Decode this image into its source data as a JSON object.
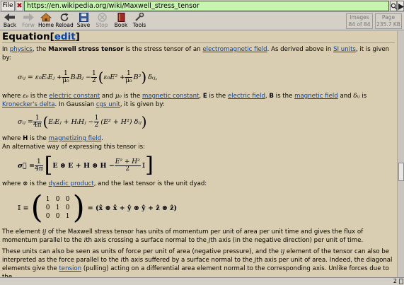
{
  "urlbar": {
    "file_label": "File",
    "close_label": "✖",
    "url": "https://en.wikipedia.org/wiki/Maxwell_stress_tensor"
  },
  "toolbar": {
    "back": "Back",
    "forw": "Forw",
    "home": "Home",
    "reload": "Reload",
    "save": "Save",
    "stop": "Stop",
    "book": "Book",
    "tools": "Tools",
    "images_label": "Images",
    "images_count": "84 of 84",
    "page_label": "Page",
    "page_size": "235.7 KB"
  },
  "article": {
    "heading": "Equation",
    "edit_label": "edit",
    "p1": {
      "t1": "In ",
      "link_physics": "physics",
      "t2": ", the ",
      "bold_term": "Maxwell stress tensor",
      "t3": " is the stress tensor of an ",
      "link_em_field": "electromagnetic field",
      "t4": ". As derived above in ",
      "link_si": "SI units",
      "t5": ", it is given by:"
    },
    "p2": {
      "t1": "where ",
      "sym_eps": "ε₀",
      "t2": " is the ",
      "link_electric_constant": "electric constant",
      "t3": " and ",
      "sym_mu": "μ₀",
      "t4": " is the ",
      "link_magnetic_constant": "magnetic constant",
      "t5": ", ",
      "sym_E": "E",
      "t6": " is the ",
      "link_electric_field": "electric field",
      "t7": ", ",
      "sym_B": "B",
      "t8": " is the ",
      "link_magnetic_field": "magnetic field",
      "t9": " and ",
      "sym_delta": "δᵢⱼ",
      "t10": " is ",
      "link_kronecker": "Kronecker's delta",
      "t11": ". In Gaussian ",
      "link_cgs": "cgs unit",
      "t12": ", it is given by:"
    },
    "p3": {
      "t1": "where ",
      "sym_H": "H",
      "t2": " is the ",
      "link_magnetizing": "magnetizing field",
      "t3": "."
    },
    "p4": "An alternative way of expressing this tensor is:",
    "p5": {
      "t1": "where ",
      "sym_otimes": "⊗",
      "t2": " is the ",
      "link_dyadic": "dyadic product",
      "t3": ", and the last tensor is the unit dyad:"
    },
    "p6": {
      "t1": "The element ",
      "sym_ij": "ij",
      "t2": " of the Maxwell stress tensor has units of momentum per unit of area per unit time and gives the flux of momentum parallel to the ",
      "sym_i": "i",
      "t3": "th axis crossing a surface normal to the ",
      "sym_j": "j",
      "t4": "th axis (in the negative direction) per unit of time."
    },
    "p7": {
      "t1": "These units can also be seen as units of force per unit of area (negative pressure), and the ",
      "sym_ij": "ij",
      "t2": " element of the tensor can also be interpreted as the force parallel to the ",
      "sym_i": "i",
      "t3": "th axis suffered by a surface normal to the ",
      "sym_j": "j",
      "t4": "th axis per unit of area. Indeed, the diagonal elements give the ",
      "link_tension": "tension",
      "t5": " (pulling) acting on a differential area element normal to the corresponding axis. Unlike forces due to the"
    },
    "eq1": {
      "lhs": "σᵢⱼ = ε₀EᵢEⱼ + ",
      "frac1_num": "1",
      "frac1_den": "μ₀",
      "mid": "BᵢBⱼ − ",
      "frac2_num": "1",
      "frac2_den": "2",
      "paren_open": "(",
      "inner1": "ε₀E² + ",
      "frac3_num": "1",
      "frac3_den": "μ₀",
      "inner2": "B²",
      "paren_close": ")",
      "tail": "δᵢⱼ",
      "comma": ","
    },
    "eq2": {
      "lhs": "σᵢⱼ = ",
      "frac_num": "1",
      "frac_den": "4π",
      "paren_open": "(",
      "body": "EᵢEⱼ + HᵢHⱼ − ",
      "frac2_num": "1",
      "frac2_den": "2",
      "inner": "(E² + H²) δᵢⱼ",
      "paren_close": ")"
    },
    "eq3": {
      "lhs": "σ⃡ = ",
      "frac_num": "1",
      "frac_den": "4π",
      "br_open": "[",
      "body": "E ⊗ E + H ⊗ H − ",
      "frac2_num": "E² + H²",
      "frac2_den": "2",
      "dyad": "𝕀",
      "br_close": "]"
    },
    "eq4": {
      "lhs": "𝕀 ≡",
      "paren_open": "(",
      "matrix": [
        "1",
        "0",
        "0",
        "0",
        "1",
        "0",
        "0",
        "0",
        "1"
      ],
      "paren_close": ")",
      "rhs": "= (x̂ ⊗ x̂ + ŷ ⊗ ŷ + ẑ ⊗ ẑ)"
    }
  },
  "statusbar": {
    "counter": "2"
  }
}
